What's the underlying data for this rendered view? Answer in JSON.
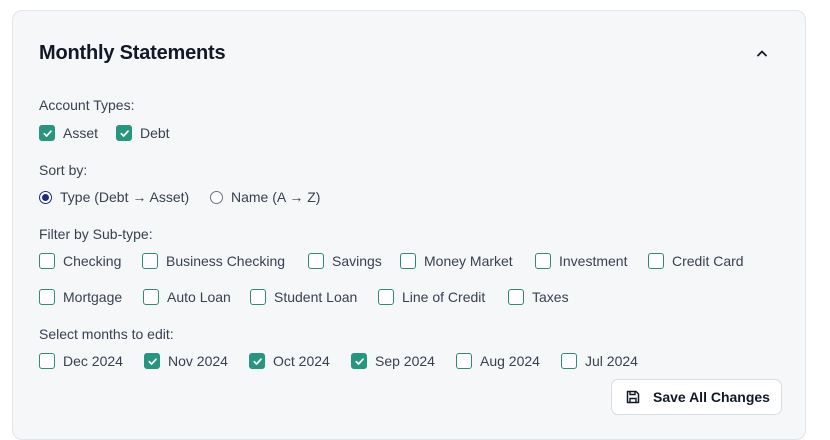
{
  "panel": {
    "title": "Monthly Statements"
  },
  "account_types": {
    "label": "Account Types:",
    "options": [
      {
        "label": "Asset",
        "checked": true
      },
      {
        "label": "Debt",
        "checked": true
      }
    ]
  },
  "sort": {
    "label": "Sort by:",
    "options": [
      {
        "label": "Type (Debt → Asset)",
        "selected": true
      },
      {
        "label": "Name (A → Z)",
        "selected": false
      }
    ]
  },
  "subtype": {
    "label": "Filter by Sub-type:",
    "options": [
      {
        "label": "Checking",
        "checked": false
      },
      {
        "label": "Business Checking",
        "checked": false
      },
      {
        "label": "Savings",
        "checked": false
      },
      {
        "label": "Money Market",
        "checked": false
      },
      {
        "label": "Investment",
        "checked": false
      },
      {
        "label": "Credit Card",
        "checked": false
      },
      {
        "label": "Mortgage",
        "checked": false
      },
      {
        "label": "Auto Loan",
        "checked": false
      },
      {
        "label": "Student Loan",
        "checked": false
      },
      {
        "label": "Line of Credit",
        "checked": false
      },
      {
        "label": "Taxes",
        "checked": false
      }
    ]
  },
  "months": {
    "label": "Select months to edit:",
    "options": [
      {
        "label": "Dec 2024",
        "checked": false
      },
      {
        "label": "Nov 2024",
        "checked": true
      },
      {
        "label": "Oct 2024",
        "checked": true
      },
      {
        "label": "Sep 2024",
        "checked": true
      },
      {
        "label": "Aug 2024",
        "checked": false
      },
      {
        "label": "Jul 2024",
        "checked": false
      }
    ]
  },
  "actions": {
    "save_label": "Save All Changes"
  },
  "colors": {
    "accent": "#27957f",
    "radio_selected": "#1e2a78",
    "panel_bg": "#f6f7f8"
  },
  "icons": {
    "collapse": "chevron-up-icon",
    "save": "floppy-disk-icon"
  }
}
